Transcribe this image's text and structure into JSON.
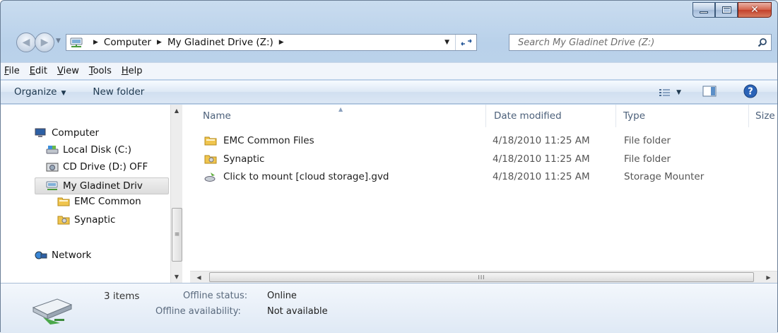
{
  "window": {
    "minimize_icon": "minimize-icon",
    "maximize_icon": "maximize-icon",
    "close_label": "✕"
  },
  "address_bar": {
    "crumbs": [
      "Computer",
      "My Gladinet Drive (Z:)"
    ],
    "search_placeholder": "Search My Gladinet Drive (Z:)"
  },
  "menu": {
    "items": [
      {
        "accel": "F",
        "rest": "ile"
      },
      {
        "accel": "E",
        "rest": "dit"
      },
      {
        "accel": "V",
        "rest": "iew"
      },
      {
        "accel": "T",
        "rest": "ools"
      },
      {
        "accel": "H",
        "rest": "elp"
      }
    ]
  },
  "toolbar": {
    "organize_label": "Organize",
    "new_folder_label": "New folder"
  },
  "nav_pane": {
    "computer": "Computer",
    "local_disk": "Local Disk (C:)",
    "cd_drive": "CD Drive (D:) OFF",
    "gladinet": "My Gladinet Driv",
    "emc": "EMC Common",
    "synaptic": "Synaptic",
    "network": "Network"
  },
  "file_list": {
    "columns": [
      "Name",
      "Date modified",
      "Type",
      "Size"
    ],
    "rows": [
      {
        "name": "EMC Common Files",
        "date": "4/18/2010 11:25 AM",
        "type": "File folder"
      },
      {
        "name": "Synaptic",
        "date": "4/18/2010 11:25 AM",
        "type": "File folder"
      },
      {
        "name": "Click to mount [cloud storage].gvd",
        "date": "4/18/2010 11:25 AM",
        "type": "Storage Mounter"
      }
    ]
  },
  "details_pane": {
    "item_count": "3 items",
    "offline_status_label": "Offline status:",
    "offline_status_value": "Online",
    "offline_availability_label": "Offline availability:",
    "offline_availability_value": "Not available"
  },
  "scrollbar": {
    "grip": "III",
    "vgrip": "≡"
  }
}
